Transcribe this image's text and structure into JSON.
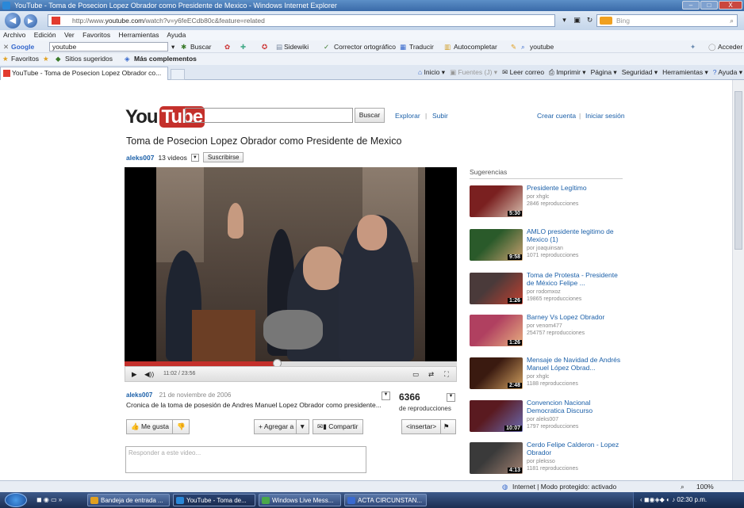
{
  "window": {
    "title": "YouTube - Toma de Posecion Lopez Obrador como Presidente de Mexico - Windows Internet Explorer",
    "min_label": "–",
    "max_label": "□",
    "close_label": "X"
  },
  "address": {
    "url_prefix": "http://www.",
    "url_domain": "youtube.com",
    "url_suffix": "/watch?v=y6feECdb80c&feature=related",
    "search_placeholder": "Bing"
  },
  "menu": [
    "Archivo",
    "Edición",
    "Ver",
    "Favoritos",
    "Herramientas",
    "Ayuda"
  ],
  "google_bar": {
    "brand": "Google",
    "query": "youtube",
    "buscar": "Buscar",
    "sidewiki": "Sidewiki",
    "corrector": "Corrector ortográfico",
    "traducir": "Traducir",
    "autocompletar": "Autocompletar",
    "youtube_btn": "youtube",
    "acceder": "Acceder"
  },
  "favorites_bar": {
    "favoritos": "Favoritos",
    "sitios": "Sitios sugeridos",
    "mas": "Más complementos"
  },
  "tab": {
    "label": "YouTube - Toma de Posecion Lopez Obrador co..."
  },
  "command_bar": [
    "Inicio",
    "Fuentes (J)",
    "Leer correo",
    "Imprimir",
    "Página",
    "Seguridad",
    "Herramientas",
    "Ayuda"
  ],
  "youtube": {
    "logo_you": "You",
    "logo_tube": "Tube",
    "search_button": "Buscar",
    "explorar": "Explorar",
    "subir": "Subir",
    "crear_cuenta": "Crear cuenta",
    "iniciar_sesion": "Iniciar sesión",
    "separator": "|",
    "video_title": "Toma de Posecion Lopez Obrador como Presidente de Mexico",
    "uploader": "aleks007",
    "video_count": "13 videos",
    "subscribe": "Suscribirse",
    "time": "11:02 / 23:56",
    "played_fraction": 0.46,
    "upload_date": "21 de noviembre de 2006",
    "description": "Cronica de la toma de posesión de Andres Manuel Lopez Obrador como presidente...",
    "views": "6366",
    "views_label": "de reproducciones",
    "me_gusta": "Me gusta",
    "agregar": "Agregar a",
    "compartir": "Compartir",
    "insertar": "<insertar>",
    "comment_placeholder": "Responder a este video...",
    "suggestions_header": "Sugerencias"
  },
  "suggestions": [
    {
      "title": "Presidente Legítimo",
      "by": "por xhglc",
      "views": "2846 reproducciones",
      "duration": "5:30"
    },
    {
      "title": "AMLO presidente legitimo de Mexico (1)",
      "by": "por joaquinsan",
      "views": "1071 reproducciones",
      "duration": "9:58"
    },
    {
      "title": "Toma de Protesta - Presidente de México Felipe ...",
      "by": "por rodomxoz",
      "views": "19865 reproducciones",
      "duration": "1:26"
    },
    {
      "title": "Barney Vs Lopez Obrador",
      "by": "por venom477",
      "views": "254757 reproducciones",
      "duration": "1:26"
    },
    {
      "title": "Mensaje de Navidad de Andrés Manuel López Obrad...",
      "by": "por xhglc",
      "views": "1188 reproducciones",
      "duration": "2:48"
    },
    {
      "title": "Convencion Nacional Democratica Discurso",
      "by": "por aleks007",
      "views": "1797 reproducciones",
      "duration": "10:07"
    },
    {
      "title": "Cerdo Felipe Calderon - Lopez Obrador",
      "by": "por pleksso",
      "views": "1181 reproducciones",
      "duration": "4:13"
    }
  ],
  "status": {
    "zone": "Internet | Modo protegido: activado",
    "zoom": "100%"
  },
  "taskbar": {
    "items": [
      "Bandeja de entrada ...",
      "YouTube - Toma de...",
      "Windows Live Mess...",
      "ACTA CIRCUNSTAN..."
    ],
    "clock": "02:30 p.m."
  },
  "colors": {
    "youtube_red": "#c4302b",
    "link_blue": "#1a5fa8",
    "ie_blue": "#3a6aa8"
  }
}
